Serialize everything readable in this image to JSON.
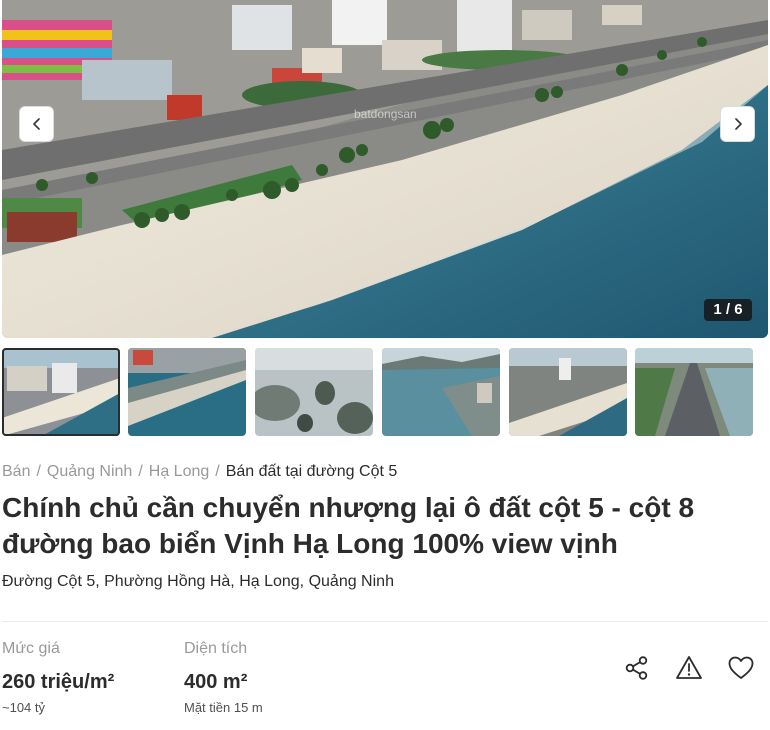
{
  "gallery": {
    "counter": "1 / 6",
    "watermark": "batdongsan",
    "thumbnail_count": 6
  },
  "breadcrumb": {
    "items": [
      "Bán",
      "Quảng Ninh",
      "Hạ Long"
    ],
    "current": "Bán đất tại đường Cột 5"
  },
  "listing": {
    "title": "Chính chủ cần chuyển nhượng lại ô đất cột 5 - cột 8 đường bao biển Vịnh Hạ Long 100% view vịnh",
    "address": "Đường Cột 5, Phường Hồng Hà, Hạ Long, Quảng Ninh"
  },
  "price": {
    "label": "Mức giá",
    "value": "260 triệu/m²",
    "sub": "~104 tỷ"
  },
  "area": {
    "label": "Diện tích",
    "value": "400 m²",
    "sub": "Mặt tiền 15 m"
  },
  "actions": {
    "share_icon": "share-icon",
    "report_icon": "warning-icon",
    "save_icon": "heart-icon"
  },
  "colors": {
    "text": "#2c2c2c",
    "muted": "#999999",
    "sea": "#2f6f86",
    "sand": "#e9e3d6"
  }
}
